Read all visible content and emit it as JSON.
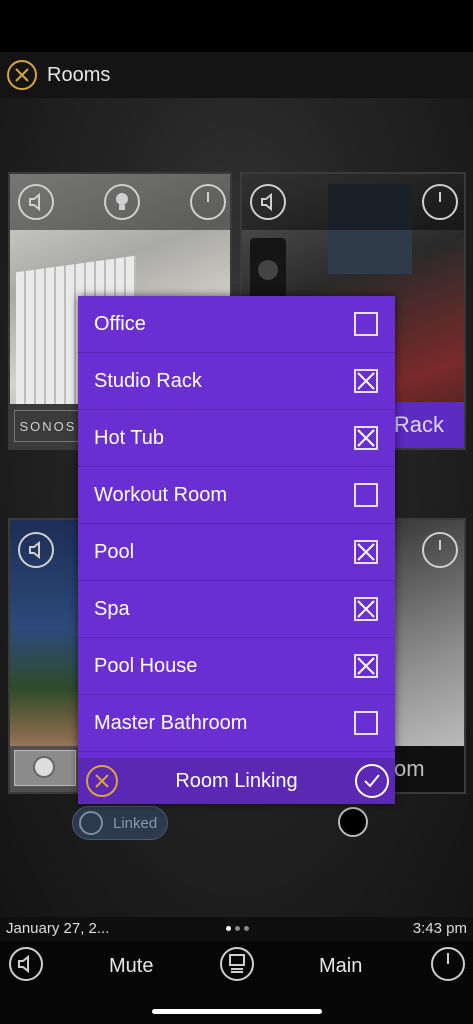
{
  "header": {
    "title": "Rooms",
    "close_icon": "close-icon"
  },
  "tiles": {
    "office": {
      "brand": "SONOS"
    },
    "studio": {
      "label_partial": "Rack"
    },
    "garage": {
      "label_partial": "om"
    }
  },
  "linked_chip": {
    "label": "Linked"
  },
  "dialog": {
    "title": "Room Linking",
    "rooms": [
      {
        "name": "Office",
        "checked": false
      },
      {
        "name": "Studio Rack",
        "checked": true
      },
      {
        "name": "Hot Tub",
        "checked": true
      },
      {
        "name": "Workout Room",
        "checked": false
      },
      {
        "name": "Pool",
        "checked": true
      },
      {
        "name": "Spa",
        "checked": true
      },
      {
        "name": "Pool House",
        "checked": true
      },
      {
        "name": "Master Bathroom",
        "checked": false
      }
    ]
  },
  "infobar": {
    "date": "January 27, 2...",
    "time": "3:43 pm"
  },
  "bottom": {
    "mute_label": "Mute",
    "main_label": "Main"
  },
  "colors": {
    "accent": "#d9a43a",
    "dialog_bg": "#6a2fd3",
    "dialog_footer": "#5a28b5"
  }
}
